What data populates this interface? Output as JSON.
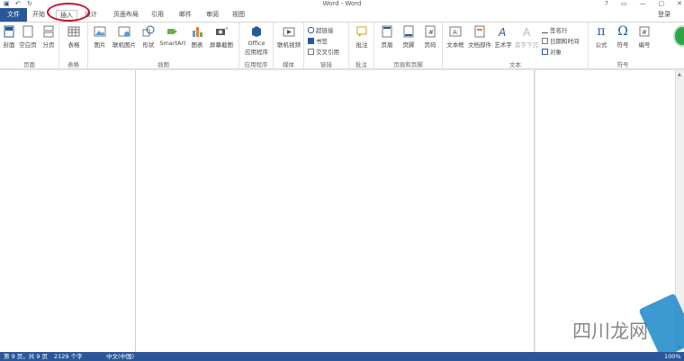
{
  "window": {
    "title": "Word - Word",
    "controls": [
      "?",
      "▭",
      "—",
      "▢",
      "✕"
    ]
  },
  "quick_access": [
    "save-icon",
    "undo-icon",
    "redo-icon"
  ],
  "tabs": {
    "file": "文件",
    "home": "开始",
    "insert": "插入",
    "design": "设计",
    "layout": "页面布局",
    "references": "引用",
    "mailings": "邮件",
    "review": "审阅",
    "view": "视图"
  },
  "login": "登录",
  "ribbon": {
    "pages": {
      "label": "页面",
      "cover": "封面",
      "blank": "空白页",
      "break": "分页"
    },
    "tables": {
      "label": "表格",
      "table": "表格"
    },
    "illustrations": {
      "label": "插图",
      "picture": "图片",
      "online_picture": "联机图片",
      "shapes": "形状",
      "smartart": "SmartArt",
      "chart": "图表",
      "screenshot": "屏幕截图"
    },
    "apps": {
      "label": "应用程序",
      "office_line1": "Office",
      "office_line2": "应用程序"
    },
    "media": {
      "label": "媒体",
      "online_video": "联机视频"
    },
    "links": {
      "label": "链接",
      "hyperlink": "超链接",
      "bookmark": "书签",
      "cross_ref": "交叉引用"
    },
    "comments": {
      "label": "批注",
      "comment": "批注"
    },
    "header_footer": {
      "label": "页眉和页脚",
      "header": "页眉",
      "footer": "页脚",
      "page_number": "页码"
    },
    "text": {
      "label": "文本",
      "textbox": "文本框",
      "quickparts": "文档部件",
      "wordart": "艺术字",
      "dropcap": "首字下沉",
      "signature": "签名行",
      "datetime": "日期和时间",
      "object": "对象"
    },
    "symbols": {
      "label": "符号",
      "equation": "公式",
      "symbol": "符号",
      "number": "编号"
    }
  },
  "status": {
    "page": "第 9 页，共 9 页",
    "words": "2129 个字",
    "language": "中文(中国)",
    "zoom": "100%"
  },
  "colors": {
    "accent": "#2b579a",
    "highlight_circle": "#c8102e"
  },
  "watermark": {
    "text": "四川龙网"
  }
}
